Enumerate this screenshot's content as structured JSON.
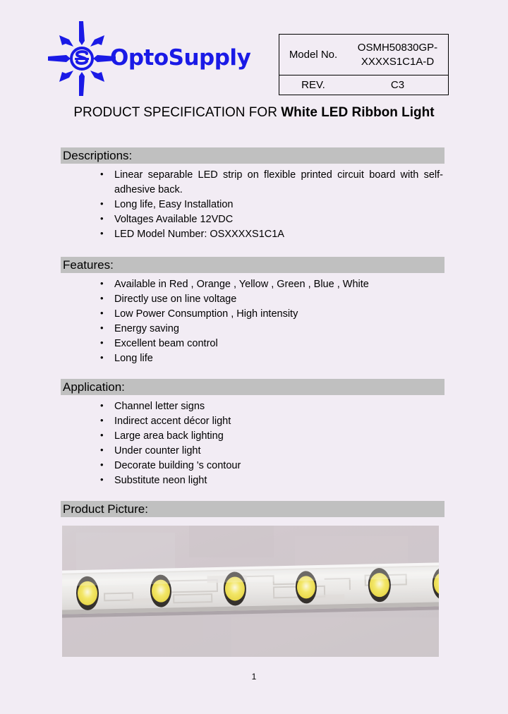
{
  "brand": {
    "name": "OptoSupply",
    "logo_icon": "starburst-s-icon",
    "color": "#1a1ae6"
  },
  "model_table": {
    "model_label": "Model No.",
    "model_value_line1": "OSMH50830GP-",
    "model_value_line2": "XXXXS1C1A-D",
    "rev_label": "REV.",
    "rev_value": "C3"
  },
  "title": {
    "prefix": "PRODUCT SPECIFICATION FOR ",
    "product": "White LED Ribbon Light"
  },
  "sections": {
    "descriptions": {
      "heading": "Descriptions:",
      "items": [
        {
          "line1": "Linear separable LED strip on flexible printed circuit board with self-",
          "line2": "adhesive back."
        },
        {
          "text": "Long life, Easy Installation"
        },
        {
          "text": "Voltages Available 12VDC"
        },
        {
          "text": "LED Model Number: OSXXXXS1C1A"
        }
      ]
    },
    "features": {
      "heading": "Features:",
      "items": [
        "Available in Red , Orange , Yellow , Green , Blue , White",
        "Directly use on line voltage",
        "Low Power Consumption , High intensity",
        "Energy saving",
        "Excellent beam control",
        "Long life"
      ]
    },
    "application": {
      "heading": "Application:",
      "items": [
        "Channel letter signs",
        "Indirect accent décor light",
        "Large area back lighting",
        "Under counter light",
        "Decorate building 's contour",
        "Substitute neon light"
      ]
    },
    "picture": {
      "heading": "Product  Picture:",
      "alt": "white-led-ribbon-strip-photo"
    }
  },
  "footer": {
    "page_number": "1"
  },
  "colors": {
    "page_background": "#f2ecf4",
    "section_bar": "#c0c0c0",
    "brand_blue": "#1a1ae6",
    "led_phosphor": "#f2e13c"
  }
}
